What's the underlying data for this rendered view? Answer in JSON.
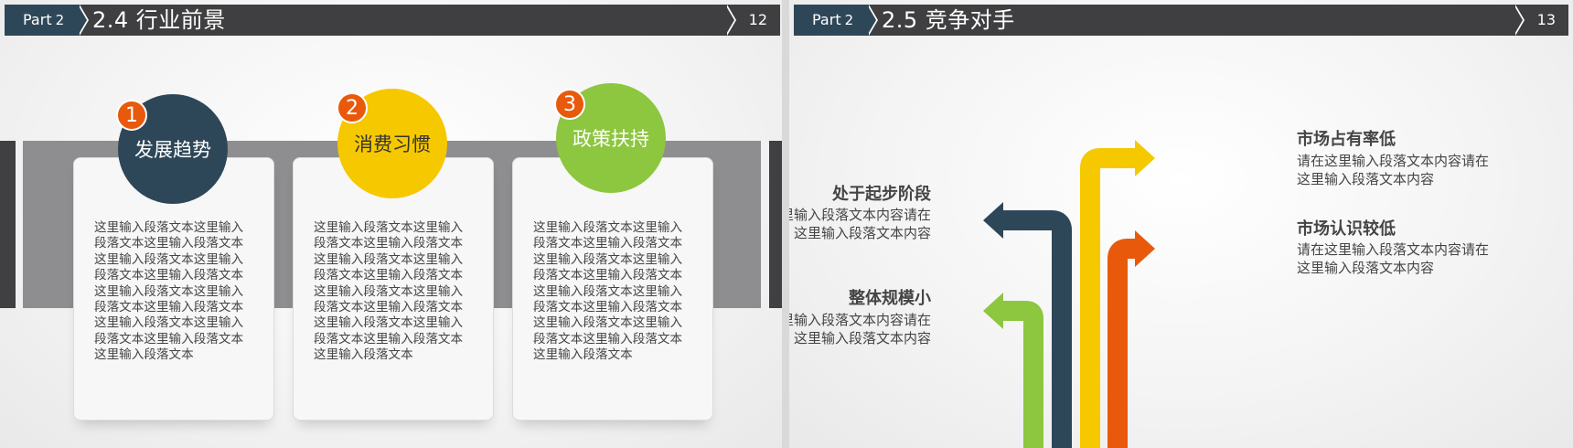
{
  "left": {
    "part_label": "Part",
    "part_num": "2",
    "title": "2.4 行业前景",
    "page": "12",
    "cards": [
      {
        "num": "1",
        "label": "发展趋势",
        "color": "#2e4758",
        "text": "这里输入段落文本这里输入段落文本这里输入段落文本这里输入段落文本这里输入段落文本这里输入段落文本这里输入段落文本这里输入段落文本这里输入段落文本这里输入段落文本这里输入段落文本这里输入段落文本这里输入段落文本"
      },
      {
        "num": "2",
        "label": "消费习惯",
        "color": "#f6c800",
        "text": "这里输入段落文本这里输入段落文本这里输入段落文本这里输入段落文本这里输入段落文本这里输入段落文本这里输入段落文本这里输入段落文本这里输入段落文本这里输入段落文本这里输入段落文本这里输入段落文本这里输入段落文本"
      },
      {
        "num": "3",
        "label": "政策扶持",
        "color": "#8dc63f",
        "text": "这里输入段落文本这里输入段落文本这里输入段落文本这里输入段落文本这里输入段落文本这里输入段落文本这里输入段落文本这里输入段落文本这里输入段落文本这里输入段落文本这里输入段落文本这里输入段落文本这里输入段落文本"
      }
    ]
  },
  "right": {
    "part_label": "Part",
    "part_num": "2",
    "title": "2.5 竞争对手",
    "page": "13",
    "items": [
      {
        "title": "市场占有率低",
        "body1": "请在这里输入段落文本内容请在",
        "body2": "这里输入段落文本内容"
      },
      {
        "title": "处于起步阶段",
        "body1": "请在这里输入段落文本内容请在",
        "body2": "这里输入段落文本内容"
      },
      {
        "title": "市场认识较低",
        "body1": "请在这里输入段落文本内容请在",
        "body2": "这里输入段落文本内容"
      },
      {
        "title": "整体规模小",
        "body1": "请在这里输入段落文本内容请在",
        "body2": "这里输入段落文本内容"
      }
    ],
    "arrow_colors": {
      "green": "#8dc63f",
      "navy": "#2e4758",
      "yellow": "#f6c800",
      "orange": "#e8590c"
    }
  }
}
